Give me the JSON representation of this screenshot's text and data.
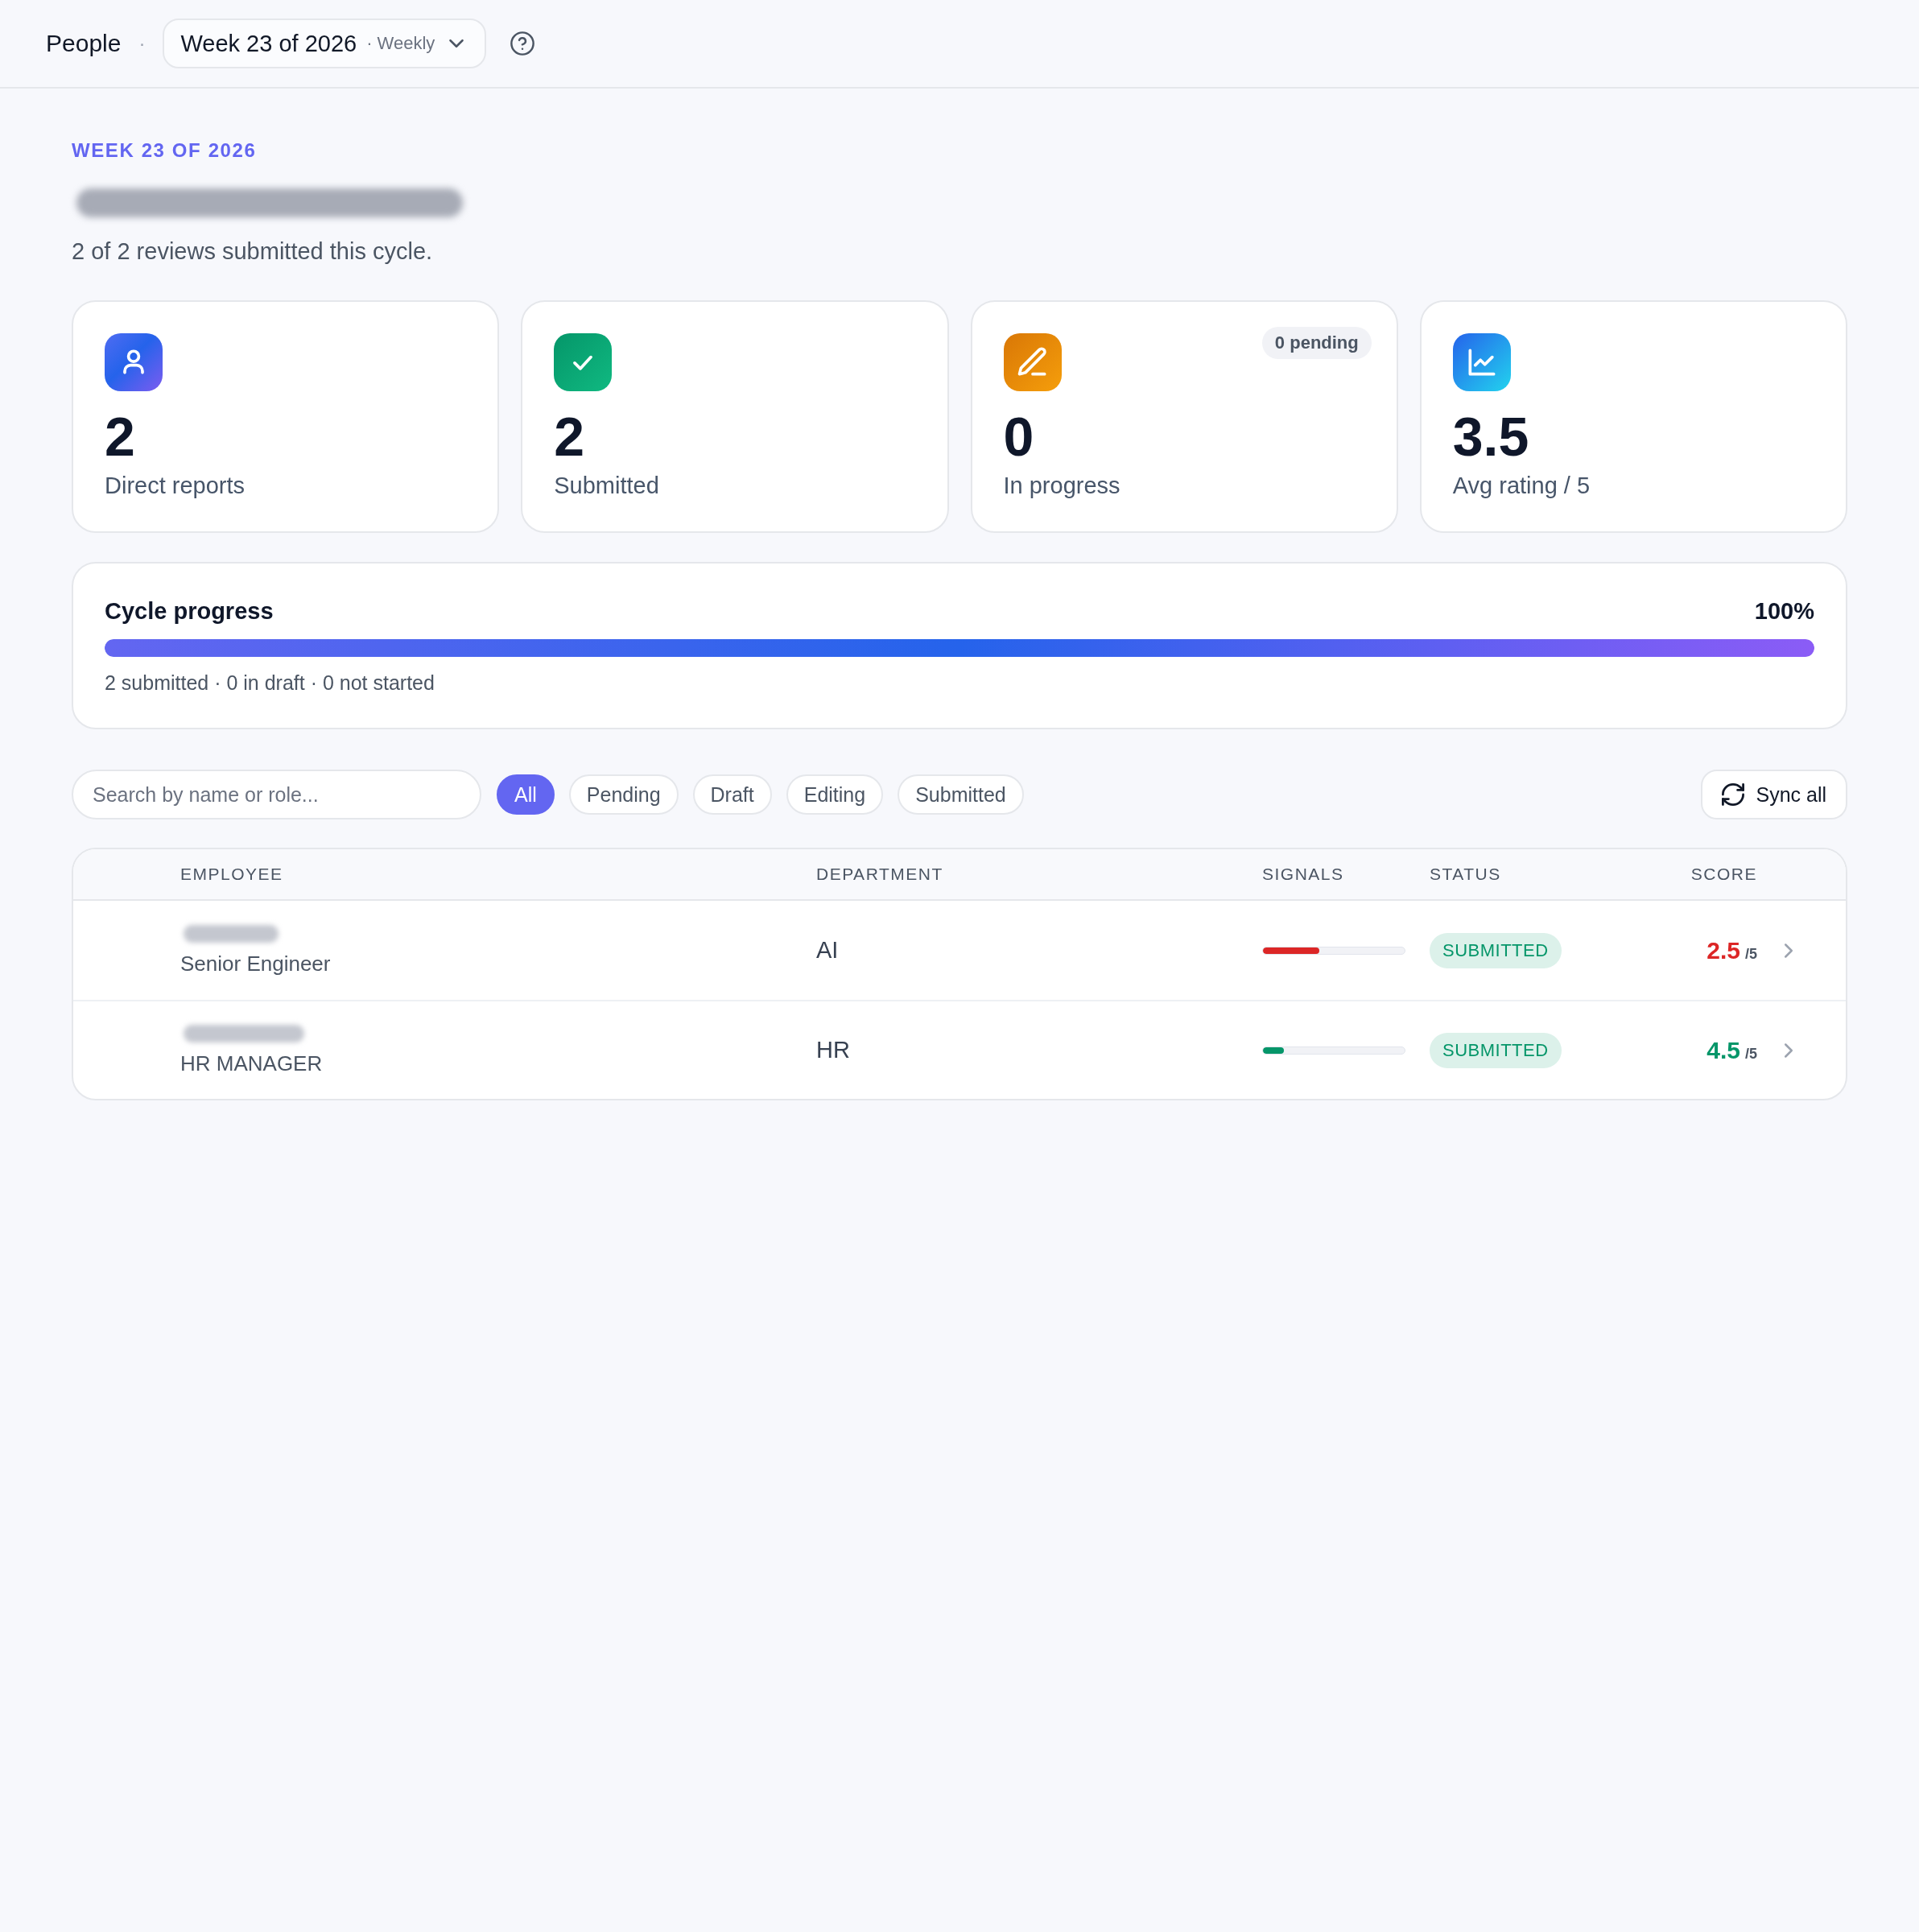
{
  "top_bar": {
    "breadcrumb": "People",
    "separator": "·",
    "period_select": {
      "value": "Week 23 of 2026",
      "cadence": "· Weekly"
    }
  },
  "header": {
    "eyebrow": "WEEK 23 OF 2026",
    "subtitle": "2 of 2 reviews submitted this cycle."
  },
  "stats": [
    {
      "kind": "reports",
      "value": "2",
      "label": "Direct reports"
    },
    {
      "kind": "submitted",
      "value": "2",
      "label": "Submitted"
    },
    {
      "kind": "progress",
      "value": "0",
      "label": "In progress",
      "badge": "0 pending"
    },
    {
      "kind": "rating",
      "value": "3.5",
      "label": "Avg rating / 5"
    }
  ],
  "cycle_progress": {
    "title": "Cycle progress",
    "percent": "100%",
    "level": 1,
    "summary": "2 submitted · 0 in draft · 0 not started"
  },
  "filters": {
    "search": {
      "placeholder": "Search by name or role..."
    },
    "chips": [
      {
        "label": "All",
        "selected": true
      },
      {
        "label": "Pending",
        "selected": false
      },
      {
        "label": "Draft",
        "selected": false
      },
      {
        "label": "Editing",
        "selected": false
      },
      {
        "label": "Submitted",
        "selected": false
      }
    ],
    "sync_button": "Sync all"
  },
  "table": {
    "columns": [
      "EMPLOYEE",
      "DEPARTMENT",
      "SIGNALS",
      "STATUS",
      "SCORE"
    ],
    "rows": [
      {
        "role": "Senior Engineer",
        "department": "AI",
        "level": 0.4,
        "color": "#dc2626",
        "status": "SUBMITTED",
        "score": "2.5",
        "score_max": "/5"
      },
      {
        "role": "HR MANAGER",
        "department": "HR",
        "level": 0.15,
        "color": "#059669",
        "status": "SUBMITTED",
        "score": "4.5",
        "score_max": "/5"
      }
    ]
  }
}
